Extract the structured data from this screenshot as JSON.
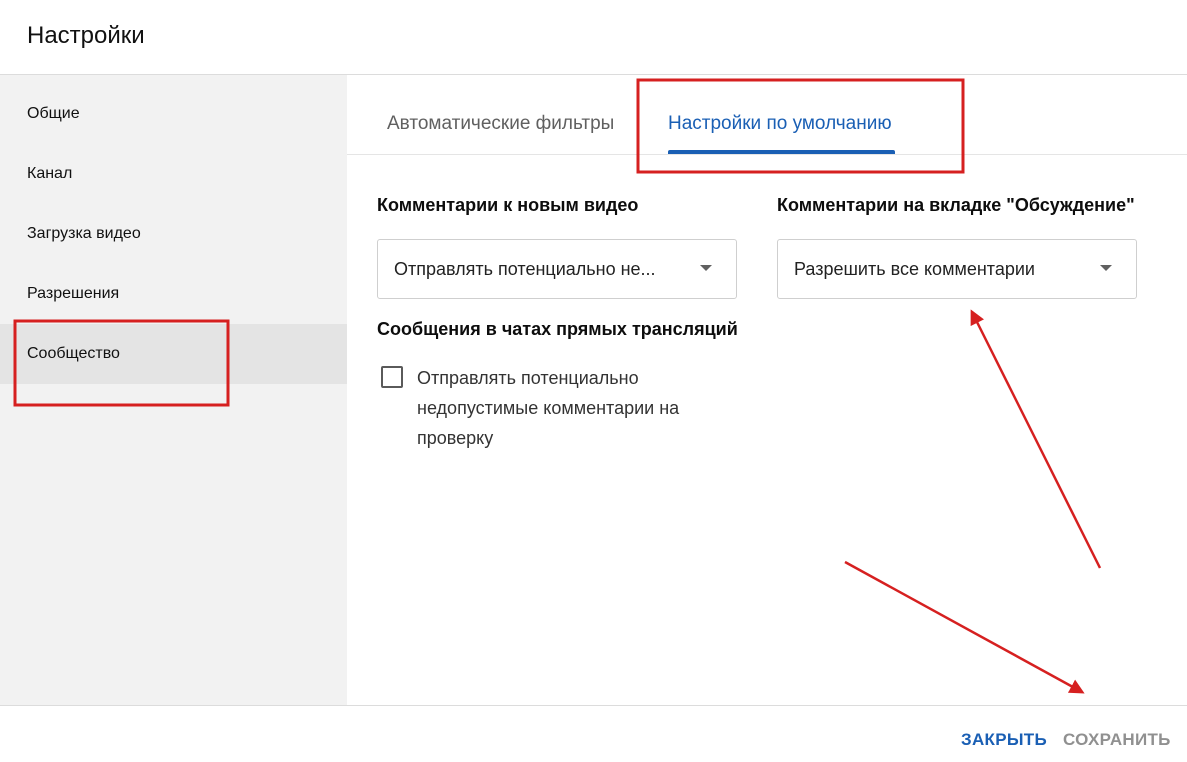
{
  "header": {
    "title": "Настройки"
  },
  "sidebar": {
    "items": [
      {
        "label": "Общие"
      },
      {
        "label": "Канал"
      },
      {
        "label": "Загрузка видео"
      },
      {
        "label": "Разрешения"
      },
      {
        "label": "Сообщество",
        "active": true
      }
    ]
  },
  "tabs": [
    {
      "label": "Автоматические фильтры"
    },
    {
      "label": "Настройки по умолчанию",
      "active": true
    }
  ],
  "main": {
    "new_video_comments": {
      "label": "Комментарии к новым видео",
      "value": "Отправлять потенциально не..."
    },
    "discussion_comments": {
      "label": "Комментарии на вкладке \"Обсуждение\"",
      "value": "Разрешить все комментарии"
    },
    "live_chat": {
      "label": "Сообщения в чатах прямых трансляций",
      "checkbox_label": "Отправлять потенциально недопустимые комментарии на проверку",
      "checked": false
    }
  },
  "footer": {
    "close_label": "ЗАКРЫТЬ",
    "save_label": "СОХРАНИТЬ"
  },
  "colors": {
    "accent": "#1a5fb4",
    "annotation": "#d62020",
    "sidebar_bg": "#f2f2f2",
    "sidebar_active_bg": "#e4e4e4"
  }
}
